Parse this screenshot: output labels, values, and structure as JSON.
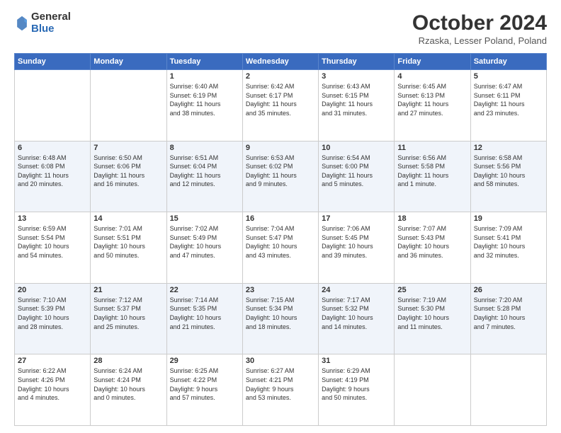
{
  "logo": {
    "general": "General",
    "blue": "Blue"
  },
  "header": {
    "month": "October 2024",
    "location": "Rzaska, Lesser Poland, Poland"
  },
  "weekdays": [
    "Sunday",
    "Monday",
    "Tuesday",
    "Wednesday",
    "Thursday",
    "Friday",
    "Saturday"
  ],
  "weeks": [
    [
      {
        "day": "",
        "details": ""
      },
      {
        "day": "",
        "details": ""
      },
      {
        "day": "1",
        "details": "Sunrise: 6:40 AM\nSunset: 6:19 PM\nDaylight: 11 hours\nand 38 minutes."
      },
      {
        "day": "2",
        "details": "Sunrise: 6:42 AM\nSunset: 6:17 PM\nDaylight: 11 hours\nand 35 minutes."
      },
      {
        "day": "3",
        "details": "Sunrise: 6:43 AM\nSunset: 6:15 PM\nDaylight: 11 hours\nand 31 minutes."
      },
      {
        "day": "4",
        "details": "Sunrise: 6:45 AM\nSunset: 6:13 PM\nDaylight: 11 hours\nand 27 minutes."
      },
      {
        "day": "5",
        "details": "Sunrise: 6:47 AM\nSunset: 6:11 PM\nDaylight: 11 hours\nand 23 minutes."
      }
    ],
    [
      {
        "day": "6",
        "details": "Sunrise: 6:48 AM\nSunset: 6:08 PM\nDaylight: 11 hours\nand 20 minutes."
      },
      {
        "day": "7",
        "details": "Sunrise: 6:50 AM\nSunset: 6:06 PM\nDaylight: 11 hours\nand 16 minutes."
      },
      {
        "day": "8",
        "details": "Sunrise: 6:51 AM\nSunset: 6:04 PM\nDaylight: 11 hours\nand 12 minutes."
      },
      {
        "day": "9",
        "details": "Sunrise: 6:53 AM\nSunset: 6:02 PM\nDaylight: 11 hours\nand 9 minutes."
      },
      {
        "day": "10",
        "details": "Sunrise: 6:54 AM\nSunset: 6:00 PM\nDaylight: 11 hours\nand 5 minutes."
      },
      {
        "day": "11",
        "details": "Sunrise: 6:56 AM\nSunset: 5:58 PM\nDaylight: 11 hours\nand 1 minute."
      },
      {
        "day": "12",
        "details": "Sunrise: 6:58 AM\nSunset: 5:56 PM\nDaylight: 10 hours\nand 58 minutes."
      }
    ],
    [
      {
        "day": "13",
        "details": "Sunrise: 6:59 AM\nSunset: 5:54 PM\nDaylight: 10 hours\nand 54 minutes."
      },
      {
        "day": "14",
        "details": "Sunrise: 7:01 AM\nSunset: 5:51 PM\nDaylight: 10 hours\nand 50 minutes."
      },
      {
        "day": "15",
        "details": "Sunrise: 7:02 AM\nSunset: 5:49 PM\nDaylight: 10 hours\nand 47 minutes."
      },
      {
        "day": "16",
        "details": "Sunrise: 7:04 AM\nSunset: 5:47 PM\nDaylight: 10 hours\nand 43 minutes."
      },
      {
        "day": "17",
        "details": "Sunrise: 7:06 AM\nSunset: 5:45 PM\nDaylight: 10 hours\nand 39 minutes."
      },
      {
        "day": "18",
        "details": "Sunrise: 7:07 AM\nSunset: 5:43 PM\nDaylight: 10 hours\nand 36 minutes."
      },
      {
        "day": "19",
        "details": "Sunrise: 7:09 AM\nSunset: 5:41 PM\nDaylight: 10 hours\nand 32 minutes."
      }
    ],
    [
      {
        "day": "20",
        "details": "Sunrise: 7:10 AM\nSunset: 5:39 PM\nDaylight: 10 hours\nand 28 minutes."
      },
      {
        "day": "21",
        "details": "Sunrise: 7:12 AM\nSunset: 5:37 PM\nDaylight: 10 hours\nand 25 minutes."
      },
      {
        "day": "22",
        "details": "Sunrise: 7:14 AM\nSunset: 5:35 PM\nDaylight: 10 hours\nand 21 minutes."
      },
      {
        "day": "23",
        "details": "Sunrise: 7:15 AM\nSunset: 5:34 PM\nDaylight: 10 hours\nand 18 minutes."
      },
      {
        "day": "24",
        "details": "Sunrise: 7:17 AM\nSunset: 5:32 PM\nDaylight: 10 hours\nand 14 minutes."
      },
      {
        "day": "25",
        "details": "Sunrise: 7:19 AM\nSunset: 5:30 PM\nDaylight: 10 hours\nand 11 minutes."
      },
      {
        "day": "26",
        "details": "Sunrise: 7:20 AM\nSunset: 5:28 PM\nDaylight: 10 hours\nand 7 minutes."
      }
    ],
    [
      {
        "day": "27",
        "details": "Sunrise: 6:22 AM\nSunset: 4:26 PM\nDaylight: 10 hours\nand 4 minutes."
      },
      {
        "day": "28",
        "details": "Sunrise: 6:24 AM\nSunset: 4:24 PM\nDaylight: 10 hours\nand 0 minutes."
      },
      {
        "day": "29",
        "details": "Sunrise: 6:25 AM\nSunset: 4:22 PM\nDaylight: 9 hours\nand 57 minutes."
      },
      {
        "day": "30",
        "details": "Sunrise: 6:27 AM\nSunset: 4:21 PM\nDaylight: 9 hours\nand 53 minutes."
      },
      {
        "day": "31",
        "details": "Sunrise: 6:29 AM\nSunset: 4:19 PM\nDaylight: 9 hours\nand 50 minutes."
      },
      {
        "day": "",
        "details": ""
      },
      {
        "day": "",
        "details": ""
      }
    ]
  ]
}
